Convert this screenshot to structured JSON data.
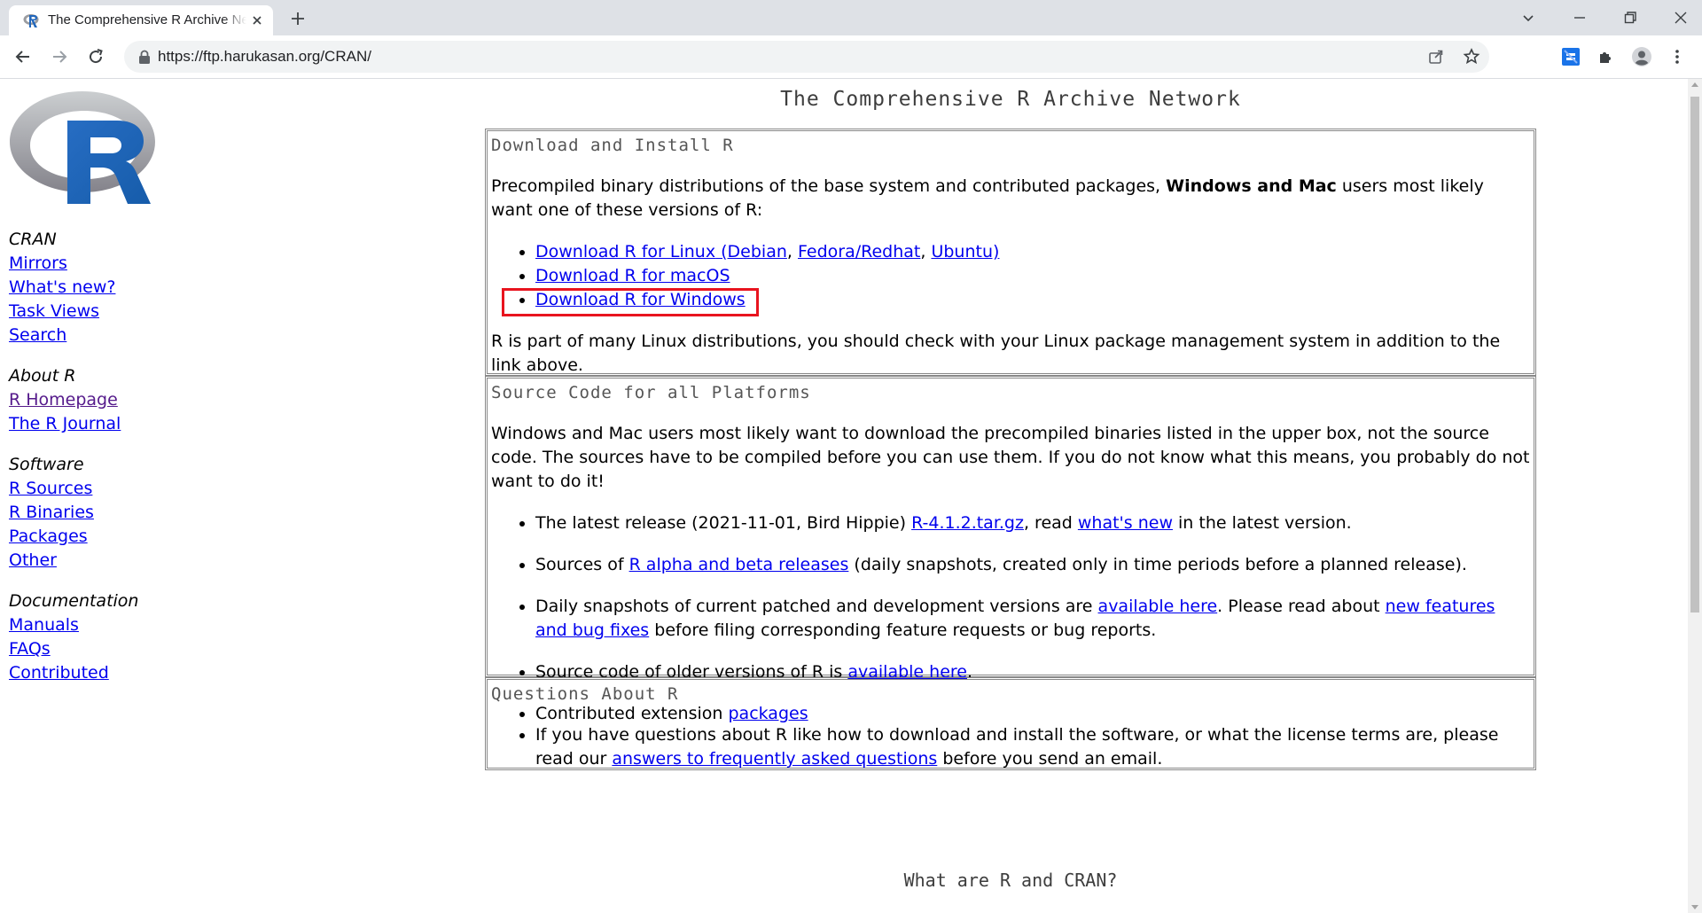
{
  "browser": {
    "tab_title": "The Comprehensive R Archive Network",
    "url": "https://ftp.harukasan.org/CRAN/"
  },
  "page": {
    "title": "The Comprehensive R Archive Network",
    "footer_title": "What are R and CRAN?"
  },
  "sidebar": {
    "groups": [
      {
        "heading": "CRAN",
        "links": [
          "Mirrors",
          "What's new?",
          "Task Views",
          "Search"
        ]
      },
      {
        "heading": "About R",
        "links": [
          "R Homepage",
          "The R Journal"
        ]
      },
      {
        "heading": "Software",
        "links": [
          "R Sources",
          "R Binaries",
          "Packages",
          "Other"
        ]
      },
      {
        "heading": "Documentation",
        "links": [
          "Manuals",
          "FAQs",
          "Contributed"
        ]
      }
    ]
  },
  "download": {
    "heading": "Download and Install R",
    "intro_pre": "Precompiled binary distributions of the base system and contributed packages, ",
    "intro_bold": "Windows and Mac",
    "intro_post": " users most likely want one of these versions of R:",
    "linux_link": "Download R for Linux",
    "linux_open": " (",
    "debian": "Debian",
    "comma1": ", ",
    "fedora": "Fedora/Redhat",
    "comma2": ", ",
    "ubuntu": "Ubuntu)",
    "macos_link": "Download R for macOS",
    "windows_link": "Download R for Windows",
    "note": "R is part of many Linux distributions, you should check with your Linux package management system in addition to the link above."
  },
  "source": {
    "heading": "Source Code for all Platforms",
    "intro": "Windows and Mac users most likely want to download the precompiled binaries listed in the upper box, not the source code. The sources have to be compiled before you can use them. If you do not know what this means, you probably do not want to do it!",
    "item1_pre": "The latest release (2021-11-01, Bird Hippie) ",
    "item1_link1": "R-4.1.2.tar.gz",
    "item1_mid": ", read ",
    "item1_link2": "what's new",
    "item1_post": " in the latest version.",
    "item2_pre": "Sources of ",
    "item2_link": "R alpha and beta releases",
    "item2_post": " (daily snapshots, created only in time periods before a planned release).",
    "item3_pre": "Daily snapshots of current patched and development versions are ",
    "item3_link1": "available here",
    "item3_mid": ". Please read about ",
    "item3_link2": "new features and bug fixes",
    "item3_post": " before filing corresponding feature requests or bug reports.",
    "item4_pre": "Source code of older versions of R is ",
    "item4_link": "available here",
    "item4_post": ".",
    "item5_pre": "Contributed extension ",
    "item5_link": "packages"
  },
  "questions": {
    "heading": "Questions About R",
    "item_pre": "If you have questions about R like how to download and install the software, or what the license terms are, please read our ",
    "item_link": "answers to frequently asked questions",
    "item_post": " before you send an email."
  },
  "colors": {
    "link": "#0000ee",
    "visited": "#551a8b",
    "highlight": "#e8141e"
  }
}
